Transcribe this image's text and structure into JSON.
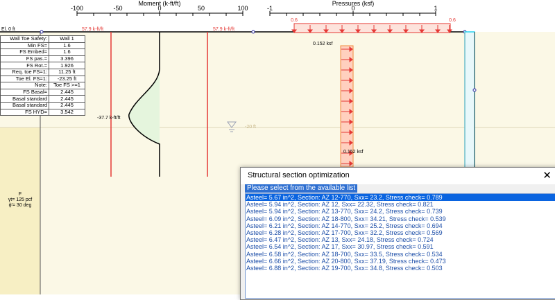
{
  "moment_axis": {
    "title": "Moment (k-ft/ft)",
    "ticks": [
      "-100",
      "-50",
      "0",
      "50",
      "100"
    ]
  },
  "pressure_axis": {
    "title": "Pressures (ksf)",
    "ticks": [
      "-1",
      "0",
      "1"
    ]
  },
  "labels": {
    "top_elevation": "El. 0 ft",
    "moment_left": "57.9 k-ft/ft",
    "moment_right": "57.9 k-ft/ft",
    "pressure_top_left": "0.6",
    "pressure_top_right": "0.6",
    "pressure_top": "0.152 ksf",
    "pressure_bottom": "0.152 ksf",
    "max_moment": "-37.7 k-ft/ft",
    "water_level": "-20 ft"
  },
  "safety_table": {
    "rows": [
      {
        "label": "Wall Toe Safety:",
        "value": "Wall 1"
      },
      {
        "label": "Min FS=",
        "value": "1.6"
      },
      {
        "label": "FS Embed=",
        "value": "1.6"
      },
      {
        "label": "FS pas.=",
        "value": "3.396"
      },
      {
        "label": "FS Rot.=",
        "value": "1.926"
      },
      {
        "label": "Req. toe FS=1:",
        "value": "11.25 ft"
      },
      {
        "label": "Toe El. FS=1:",
        "value": "-23.25 ft"
      },
      {
        "label": "Note:",
        "value": "Toe FS >=1"
      },
      {
        "label": "FS Basal=",
        "value": "2.445"
      },
      {
        "label": "Basal standard",
        "value": "2.445"
      },
      {
        "label": "Basal standard",
        "value": "2.445"
      },
      {
        "label": "FS HYD=",
        "value": "3.542"
      }
    ]
  },
  "soil": {
    "name": "F",
    "unit_weight": "γt= 125 pcf",
    "friction": "ϕ'= 30 deg"
  },
  "dialog": {
    "title": "Structural section optimization",
    "close_glyph": "✕",
    "group_label": "Please select from the available list",
    "items": [
      "Asteel= 5.67 in^2, Section: AZ 12-770, Sxx= 23.2, Stress check= 0.789",
      "Asteel= 5.94 in^2, Section: AZ 12, Sxx= 22.32, Stress check= 0.821",
      "Asteel= 5.94 in^2, Section: AZ 13-770, Sxx= 24.2, Stress check= 0.739",
      "Asteel= 6.09 in^2, Section: AZ 18-800, Sxx= 34.21, Stress check= 0.539",
      "Asteel= 6.21 in^2, Section: AZ 14-770, Sxx= 25.2, Stress check= 0.694",
      "Asteel= 6.28 in^2, Section: AZ 17-700, Sxx= 32.2, Stress check= 0.569",
      "Asteel= 6.47 in^2, Section: AZ 13, Sxx= 24.18, Stress check= 0.724",
      "Asteel= 6.54 in^2, Section: AZ 17, Sxx= 30.97, Stress check= 0.591",
      "Asteel= 6.58 in^2, Section: AZ 18-700, Sxx= 33.5, Stress check= 0.534",
      "Asteel= 6.66 in^2, Section: AZ 20-800, Sxx= 37.19, Stress check= 0.473",
      "Asteel= 6.88 in^2, Section: AZ 19-700, Sxx= 34.8, Stress check= 0.503"
    ],
    "selected_index": 0
  },
  "colors": {
    "soil": "#fbf8e6",
    "soil_left": "#f7efc4",
    "moment_fill": "#e5f5dd",
    "pressure_fill": "#ffd0bf",
    "red": "#e53935",
    "wall_cyan": "#26d4f0",
    "selection": "#0a64e0"
  }
}
